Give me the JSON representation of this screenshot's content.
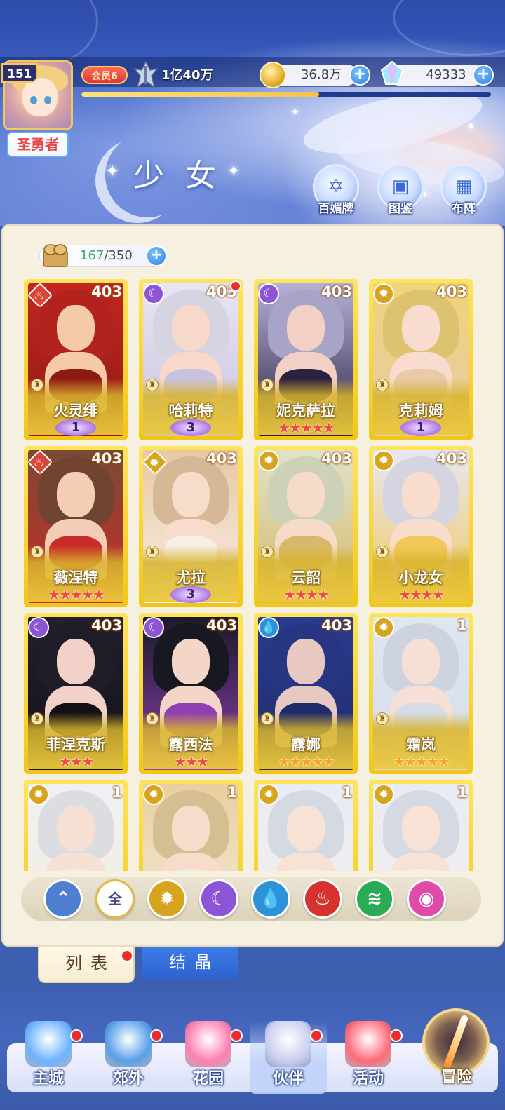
{
  "player": {
    "level": "151",
    "title": "圣勇者",
    "vip_label": "会员6",
    "power": "1亿40万",
    "xp_progress": 0.58
  },
  "currency": {
    "gold": "36.8万",
    "diamond": "49333",
    "add_symbol": "+"
  },
  "page": {
    "title": "少女"
  },
  "header_buttons": [
    {
      "label": "百媚牌",
      "icon": "card-deck-icon"
    },
    {
      "label": "图鉴",
      "icon": "book-icon"
    },
    {
      "label": "布阵",
      "icon": "formation-grid-icon"
    }
  ],
  "capacity": {
    "current": "167",
    "max": "/350"
  },
  "cards": [
    {
      "name": "火灵绯",
      "level": "403",
      "element": "fire",
      "elem_glyph": "♨",
      "diamond": true,
      "rank_type": "wing",
      "rank": "1",
      "stars": 0,
      "dot": false,
      "palette": [
        "#c2261f",
        "#8e1a14",
        "#f4caa8"
      ]
    },
    {
      "name": "哈莉特",
      "level": "403",
      "element": "moon",
      "elem_glyph": "☾",
      "diamond": false,
      "rank_type": "wing",
      "rank": "3",
      "stars": 0,
      "dot": true,
      "palette": [
        "#e8e6f4",
        "#c8c2df",
        "#f6d9cb"
      ]
    },
    {
      "name": "妮克萨拉",
      "level": "403",
      "element": "moon",
      "elem_glyph": "☾",
      "diamond": false,
      "rank_type": "stars",
      "rank": "",
      "stars": 5,
      "star_color": "red",
      "dot": false,
      "palette": [
        "#b5b2d8",
        "#2b2140",
        "#f2d0c6"
      ]
    },
    {
      "name": "克莉姆",
      "level": "403",
      "element": "light",
      "elem_glyph": "✹",
      "diamond": false,
      "rank_type": "wing",
      "rank": "1",
      "stars": 0,
      "dot": false,
      "palette": [
        "#f0d47a",
        "#e8c9a8",
        "#f8dccf"
      ]
    },
    {
      "name": "薇涅特",
      "level": "403",
      "element": "fire",
      "elem_glyph": "♨",
      "diamond": true,
      "rank_type": "stars",
      "rank": "",
      "stars": 5,
      "star_color": "red",
      "dot": false,
      "palette": [
        "#7a4a34",
        "#c92b2b",
        "#f3cdb5"
      ]
    },
    {
      "name": "尤拉",
      "level": "403",
      "element": "light",
      "elem_glyph": "✹",
      "diamond": true,
      "rank_type": "wing",
      "rank": "3",
      "stars": 0,
      "dot": false,
      "palette": [
        "#e8c8a2",
        "#f6efe8",
        "#f8dccb"
      ]
    },
    {
      "name": "云韶",
      "level": "403",
      "element": "light",
      "elem_glyph": "✹",
      "diamond": false,
      "rank_type": "stars",
      "rank": "",
      "stars": 4,
      "star_color": "red",
      "dot": false,
      "palette": [
        "#dfe3c8",
        "#d8b86a",
        "#f6dcc8"
      ]
    },
    {
      "name": "小龙女",
      "level": "403",
      "element": "light",
      "elem_glyph": "✹",
      "diamond": false,
      "rank_type": "stars",
      "rank": "",
      "stars": 4,
      "star_color": "red",
      "dot": false,
      "palette": [
        "#e6e8f4",
        "#f2c85a",
        "#f8dccc"
      ]
    },
    {
      "name": "菲涅克斯",
      "level": "403",
      "element": "moon",
      "elem_glyph": "☾",
      "diamond": false,
      "rank_type": "stars",
      "rank": "",
      "stars": 3,
      "star_color": "red",
      "dot": false,
      "palette": [
        "#22202a",
        "#121016",
        "#f2d2c8"
      ]
    },
    {
      "name": "露西法",
      "level": "403",
      "element": "moon",
      "elem_glyph": "☾",
      "diamond": false,
      "rank_type": "stars",
      "rank": "",
      "stars": 3,
      "star_color": "red",
      "dot": false,
      "palette": [
        "#1a1a26",
        "#8e3fb2",
        "#f4d6c8"
      ]
    },
    {
      "name": "露娜",
      "level": "403",
      "element": "water",
      "elem_glyph": "💧",
      "diamond": false,
      "rank_type": "stars",
      "rank": "",
      "stars": 5,
      "star_color": "gold",
      "dot": false,
      "palette": [
        "#2a3b8e",
        "#1f2b6a",
        "#e7c9c2"
      ]
    },
    {
      "name": "霜岚",
      "level": "1",
      "element": "light",
      "elem_glyph": "✹",
      "diamond": false,
      "rank_type": "stars",
      "rank": "",
      "stars": 5,
      "star_color": "gold",
      "dot": false,
      "palette": [
        "#dfe6f2",
        "#d6dde8",
        "#f6e0d6"
      ]
    },
    {
      "name": "",
      "level": "1",
      "element": "light",
      "elem_glyph": "✹",
      "diamond": false,
      "rank_type": "none",
      "rank": "",
      "stars": 0,
      "dot": false,
      "palette": [
        "#eef0f4",
        "#f4eedc",
        "#f6e0d4"
      ]
    },
    {
      "name": "",
      "level": "1",
      "element": "light",
      "elem_glyph": "✹",
      "diamond": false,
      "rank_type": "none",
      "rank": "",
      "stars": 0,
      "dot": false,
      "palette": [
        "#e8cf9e",
        "#f4eadc",
        "#f7dccb"
      ]
    },
    {
      "name": "",
      "level": "1",
      "element": "light",
      "elem_glyph": "✹",
      "diamond": false,
      "rank_type": "none",
      "rank": "",
      "stars": 0,
      "dot": false,
      "palette": [
        "#e8ecf6",
        "#f6eee8",
        "#f8e2d6"
      ]
    },
    {
      "name": "",
      "level": "1",
      "element": "light",
      "elem_glyph": "✹",
      "diamond": false,
      "rank_type": "none",
      "rank": "",
      "stars": 0,
      "dot": false,
      "palette": [
        "#e8ecf6",
        "#f6eee8",
        "#f8e2d6"
      ]
    }
  ],
  "filters": [
    {
      "id": "rarity",
      "glyph": "⌃",
      "color": "#4f7fd0",
      "icon": "wings-filter-icon"
    },
    {
      "id": "all",
      "glyph": "全",
      "color": "#ffffff",
      "text_color": "#4a4a7a",
      "icon": "all-filter-icon"
    },
    {
      "id": "light",
      "glyph": "✹",
      "color": "#d7a41f",
      "icon": "light-element-icon"
    },
    {
      "id": "moon",
      "glyph": "☾",
      "color": "#8b55d6",
      "icon": "moon-element-icon"
    },
    {
      "id": "water",
      "glyph": "💧",
      "color": "#2d92d8",
      "icon": "water-element-icon"
    },
    {
      "id": "fire",
      "glyph": "♨",
      "color": "#d8322e",
      "icon": "fire-element-icon"
    },
    {
      "id": "wind",
      "glyph": "≋",
      "color": "#2bab54",
      "icon": "wind-element-icon"
    },
    {
      "id": "spirit",
      "glyph": "◉",
      "color": "#e04aa8",
      "icon": "spirit-element-icon"
    }
  ],
  "tabs": {
    "list": "列表",
    "crystal": "结晶"
  },
  "nav": [
    {
      "label": "主城",
      "icon": "castle-icon",
      "color": "#6db3ff",
      "dot": true,
      "active": false
    },
    {
      "label": "郊外",
      "icon": "portal-icon",
      "color": "#58a0e8",
      "dot": true,
      "active": false
    },
    {
      "label": "花园",
      "icon": "heart-icon",
      "color": "#ff7fb0",
      "dot": true,
      "active": false
    },
    {
      "label": "伙伴",
      "icon": "partner-icon",
      "color": "#c9cff0",
      "dot": true,
      "active": true
    },
    {
      "label": "活动",
      "icon": "gift-icon",
      "color": "#ff6a7a",
      "dot": true,
      "active": false
    }
  ],
  "adventure": {
    "label": "冒险",
    "icon": "sword-icon"
  }
}
